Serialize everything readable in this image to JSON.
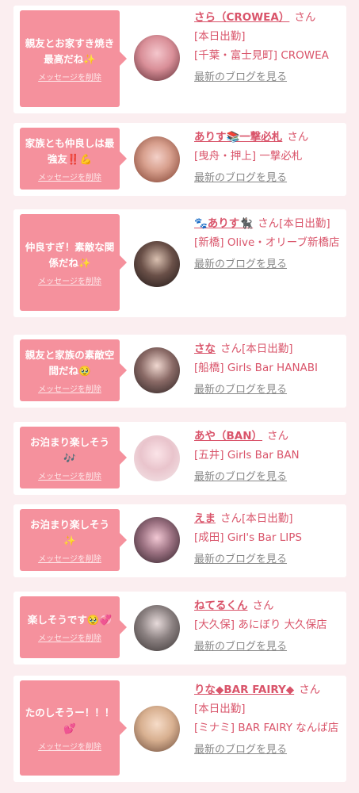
{
  "san_label": "さん",
  "delete_label": "メッセージを削除",
  "blog_label": "最新のブログを見る",
  "cards": [
    {
      "message": "親友とお家すき焼き最高だね✨",
      "name": "さら（CROWEA）",
      "status": "[本日出勤]",
      "shop_area": "[千葉・富士見町]",
      "shop_name": "CROWEA"
    },
    {
      "message": "家族とも仲良しは最強友‼️💪",
      "name": "ありす📚一撃必札",
      "status": "",
      "shop_area": "[曳舟・押上]",
      "shop_name": "一撃必札"
    },
    {
      "message": "仲良すぎ！素敵な関係だね✨",
      "name": "🐾ありす🐈‍⬛",
      "status": "[本日出勤]",
      "shop_area": "[新橋]",
      "shop_name": "Olive・オリーブ新橋店"
    },
    {
      "message": "親友と家族の素敵空間だね🥹",
      "name": "さな",
      "status": "[本日出勤]",
      "shop_area": "[船橋]",
      "shop_name": "Girls Bar HANABI"
    },
    {
      "message": "お泊まり楽しそう🎶",
      "name": "あや（BAN）",
      "status": "",
      "shop_area": "[五井]",
      "shop_name": "Girls Bar BAN"
    },
    {
      "message": "お泊まり楽しそう✨",
      "name": "えま",
      "status": "[本日出勤]",
      "shop_area": "[成田]",
      "shop_name": "Girl's Bar LIPS"
    },
    {
      "message": "楽しそうです🥹💞",
      "name": "ねてるくん",
      "status": "",
      "shop_area": "[大久保]",
      "shop_name": "あにぼり 大久保店"
    },
    {
      "message": "たのしそうー！！！💕",
      "name": "りな◆BAR FAIRY◆",
      "status": "[本日出勤]",
      "shop_area": "[ミナミ]",
      "shop_name": "BAR FAIRY なんば店"
    }
  ]
}
